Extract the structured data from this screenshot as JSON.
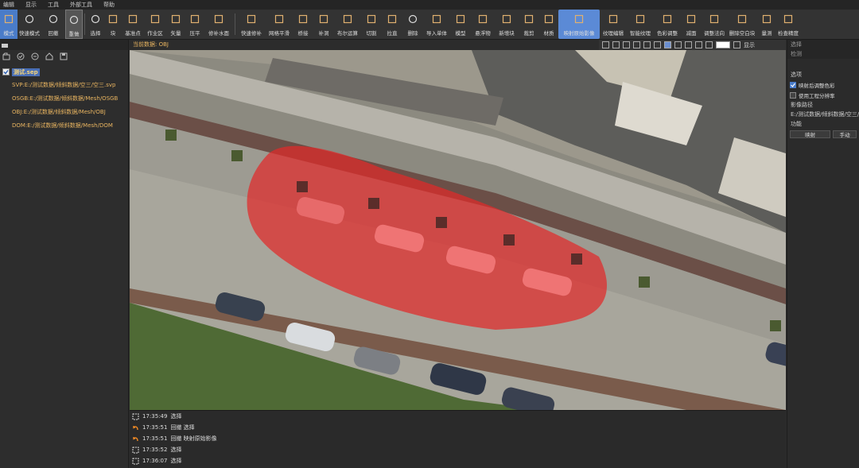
{
  "menu": [
    "编辑",
    "显示",
    "工具",
    "外部工具",
    "帮助"
  ],
  "ribbon": {
    "tools": [
      {
        "key": "mode",
        "label": "模式",
        "icon": "mode-icon",
        "state": "active"
      },
      {
        "key": "fast-mode",
        "label": "快速模式",
        "icon": "lightning-icon"
      },
      {
        "key": "undo",
        "label": "回撤",
        "icon": "undo-icon"
      },
      {
        "key": "redo",
        "label": "重做",
        "icon": "redo-icon",
        "state": "pressed"
      },
      {
        "key": "select",
        "label": "选择",
        "icon": "cursor-icon"
      },
      {
        "key": "block",
        "label": "块",
        "icon": "block-icon"
      },
      {
        "key": "base-plane",
        "label": "基准点",
        "icon": "base-point-icon"
      },
      {
        "key": "work-area",
        "label": "作业区",
        "icon": "work-area-icon"
      },
      {
        "key": "vector",
        "label": "矢量",
        "icon": "vector-icon"
      },
      {
        "key": "flatten",
        "label": "压平",
        "icon": "flatten-icon"
      },
      {
        "key": "water-fill",
        "label": "修补水面",
        "icon": "water-icon"
      },
      {
        "key": "fast-fill",
        "label": "快速修补",
        "icon": "fast-fill-icon"
      },
      {
        "key": "mesh-smooth",
        "label": "网格平滑",
        "icon": "smooth-icon"
      },
      {
        "key": "bridge",
        "label": "桥接",
        "icon": "bridge-icon"
      },
      {
        "key": "patch",
        "label": "补洞",
        "icon": "patch-icon"
      },
      {
        "key": "boolean",
        "label": "布尔运算",
        "icon": "boolean-icon"
      },
      {
        "key": "cut-line",
        "label": "切割",
        "icon": "pen-icon"
      },
      {
        "key": "stretch",
        "label": "拉直",
        "icon": "stretch-icon"
      },
      {
        "key": "delete",
        "label": "删除",
        "icon": "trash-icon"
      },
      {
        "key": "import-single",
        "label": "导入单体",
        "icon": "import-icon"
      },
      {
        "key": "model",
        "label": "模型",
        "icon": "model-icon"
      },
      {
        "key": "float",
        "label": "悬浮物",
        "icon": "float-icon"
      },
      {
        "key": "new-block",
        "label": "新增块",
        "icon": "new-block-icon"
      },
      {
        "key": "crop",
        "label": "裁剪",
        "icon": "crop-icon"
      },
      {
        "key": "material",
        "label": "材质",
        "icon": "material-icon"
      },
      {
        "key": "map-original",
        "label": "映射原始影像",
        "icon": "map-image-icon",
        "state": "highlight"
      },
      {
        "key": "texture-edit",
        "label": "纹理编辑",
        "icon": "texture-icon"
      },
      {
        "key": "smart-texture",
        "label": "智能纹理",
        "icon": "ai-icon"
      },
      {
        "key": "color-adjust",
        "label": "色彩调整",
        "icon": "color-icon"
      },
      {
        "key": "dim",
        "label": "减面",
        "icon": "reduce-icon"
      },
      {
        "key": "adjust-normal",
        "label": "调整法向",
        "icon": "normal-icon"
      },
      {
        "key": "del-blank",
        "label": "删除空白块",
        "icon": "delete-blank-icon"
      },
      {
        "key": "measure",
        "label": "量测",
        "icon": "measure-icon"
      },
      {
        "key": "check-precision",
        "label": "检查精度",
        "icon": "precision-icon"
      }
    ]
  },
  "left_panel": {
    "root": "测试.sep",
    "items": [
      "SVP:E:/测试数据/倾斜数据/空三/空三.svp",
      "OSGB:E:/测试数据/倾斜数据/Mesh/OSGB",
      "OBJ:E:/测试数据/倾斜数据/Mesh/OBJ",
      "DOM:E:/测试数据/倾斜数据/Mesh/DOM"
    ]
  },
  "viewport": {
    "current_data": "当前数据: OBJ",
    "display_label": "显示"
  },
  "right_panel": {
    "header1": "选择",
    "header2": "检测",
    "options_title": "选项",
    "option1": "映射后调整色彩",
    "option2": "使用工程分辨率",
    "path_title": "影像路径",
    "path_value": "E:/测试数据/倾斜数据/空三/空三.svp",
    "func_title": "功能",
    "btn_map": "映射",
    "btn_manual": "手动"
  },
  "log": [
    {
      "time": "17:35:49",
      "text": "选择",
      "type": "select"
    },
    {
      "time": "17:35:51",
      "text": "回撤 选择",
      "type": "undo"
    },
    {
      "time": "17:35:51",
      "text": "回撤 映射原始影像",
      "type": "undo"
    },
    {
      "time": "17:35:52",
      "text": "选择",
      "type": "select"
    },
    {
      "time": "17:36:07",
      "text": "选择",
      "type": "select"
    }
  ],
  "colors": {
    "accent": "#4a7cc9",
    "orange_text": "#e8b460",
    "selection_red": "#e02a2a"
  }
}
